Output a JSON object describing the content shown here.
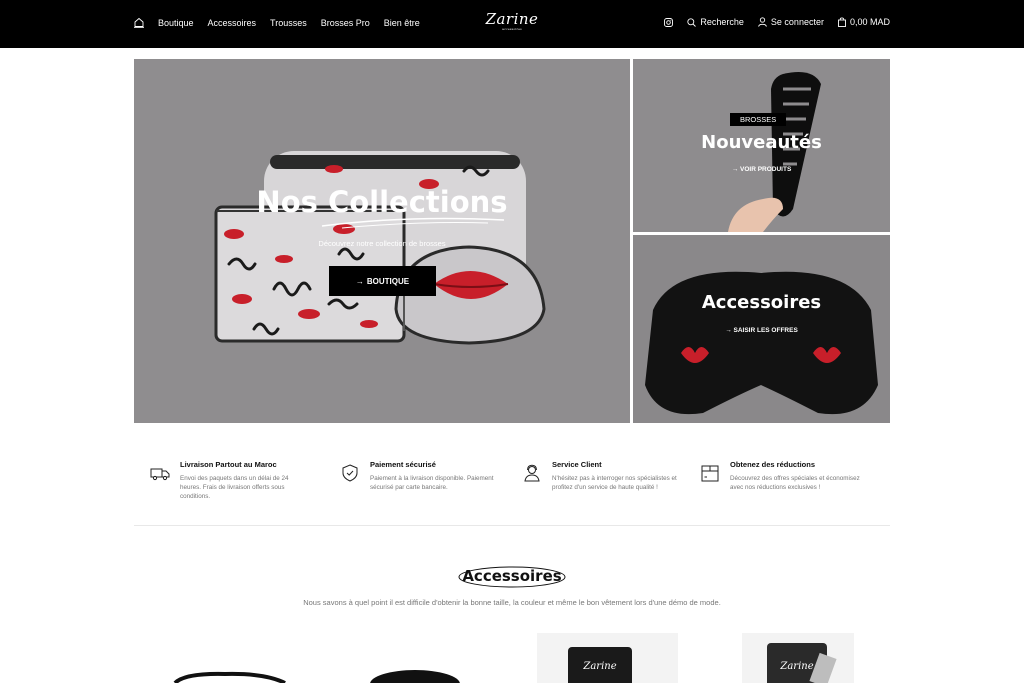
{
  "header": {
    "nav_left": [
      "Boutique",
      "Accessoires",
      "Trousses",
      "Brosses Pro",
      "Bien être"
    ],
    "logo_text": "Zarine",
    "logo_sub": "accessoires",
    "search_label": "Recherche",
    "login_label": "Se connecter",
    "cart_label": "0,00 MAD"
  },
  "hero": {
    "main": {
      "title": "Nos Collections",
      "subtitle": "Découvrez notre collection de brosses",
      "button_label": "BOUTIQUE"
    },
    "top_right": {
      "tag": "BROSSES",
      "title": "Nouveautés",
      "link_label": "VOIR PRODUITS"
    },
    "bottom_right": {
      "title": "Accessoires",
      "link_label": "SAISIR LES OFFRES"
    }
  },
  "features": [
    {
      "title": "Livraison Partout au Maroc",
      "text": "Envoi des paquets dans un délai de 24 heures. Frais de livraison offerts sous conditions.",
      "icon": "truck-icon"
    },
    {
      "title": "Paiement sécurisé",
      "text": "Paiement à la livraison disponible. Paiement sécurisé par carte bancaire.",
      "icon": "shield-check-icon"
    },
    {
      "title": "Service Client",
      "text": "N'hésitez pas à interroger nos spécialistes et profitez d'un service de haute qualité !",
      "icon": "support-agent-icon"
    },
    {
      "title": "Obtenez des réductions",
      "text": "Découvrez des offres spéciales et économisez avec nos réductions exclusives !",
      "icon": "box-icon"
    }
  ],
  "section": {
    "title": "Accessoires",
    "description": "Nous savons à quel point il est difficile d'obtenir la bonne taille, la couleur et même le bon vêtement lors d'une démo de mode."
  },
  "products": [
    {
      "brand": ""
    },
    {
      "brand": ""
    },
    {
      "brand": "Zarine"
    },
    {
      "brand": "Zarine"
    }
  ]
}
